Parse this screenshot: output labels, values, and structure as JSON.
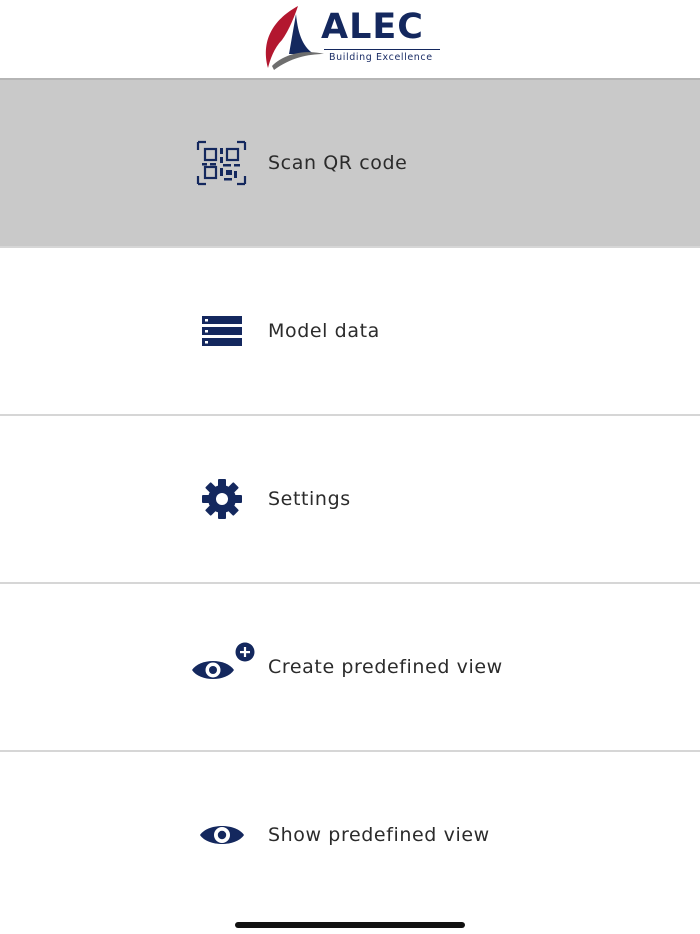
{
  "header": {
    "logo_text": "ALEC",
    "logo_tagline": "Building Excellence"
  },
  "colors": {
    "accent": "#14285e",
    "logo_red": "#b3172f",
    "active_row": "#c9c9c9"
  },
  "menu": {
    "items": [
      {
        "label": "Scan QR code",
        "icon": "qr-code-icon",
        "active": true
      },
      {
        "label": "Model data",
        "icon": "list-icon",
        "active": false
      },
      {
        "label": "Settings",
        "icon": "gear-icon",
        "active": false
      },
      {
        "label": "Create predefined view",
        "icon": "eye-plus-icon",
        "active": false
      },
      {
        "label": "Show predefined view",
        "icon": "eye-icon",
        "active": false
      }
    ]
  }
}
